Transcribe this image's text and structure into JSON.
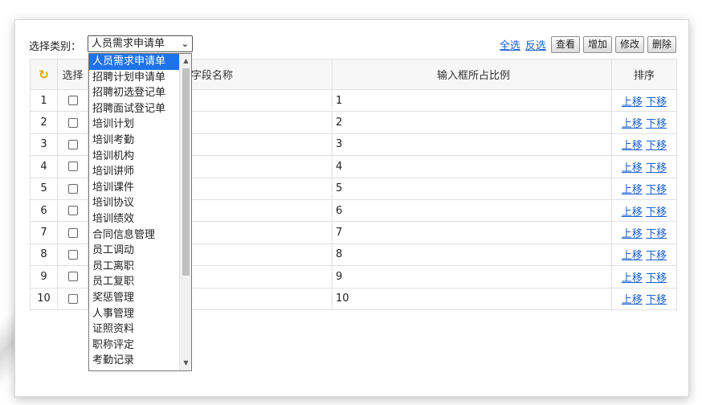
{
  "toolbar": {
    "category_label": "选择类别：",
    "category_value": "人员需求申请单",
    "select_all": "全选",
    "invert": "反选",
    "buttons": [
      "查看",
      "增加",
      "修改",
      "删除"
    ]
  },
  "table": {
    "headers": {
      "select": "选择",
      "field_name": "字段名称",
      "ratio": "输入框所占比例",
      "sort": "排序"
    },
    "rows": [
      {
        "idx": "1",
        "ratio": "1"
      },
      {
        "idx": "2",
        "ratio": "2"
      },
      {
        "idx": "3",
        "ratio": "3"
      },
      {
        "idx": "4",
        "ratio": "4"
      },
      {
        "idx": "5",
        "ratio": "5"
      },
      {
        "idx": "6",
        "ratio": "6"
      },
      {
        "idx": "7",
        "ratio": "7"
      },
      {
        "idx": "8",
        "ratio": "8"
      },
      {
        "idx": "9",
        "ratio": "9"
      },
      {
        "idx": "10",
        "ratio": "10"
      }
    ],
    "move_up": "上移",
    "move_down": "下移"
  },
  "dropdown": {
    "options": [
      "人员需求申请单",
      "招聘计划申请单",
      "招聘初选登记单",
      "招聘面试登记单",
      "培训计划",
      "培训考勤",
      "培训机构",
      "培训讲师",
      "培训课件",
      "培训协议",
      "培训绩效",
      "合同信息管理",
      "员工调动",
      "员工离职",
      "员工复职",
      "奖惩管理",
      "人事管理",
      "证照资料",
      "职称评定",
      "考勤记录"
    ],
    "selected_index": 0
  },
  "colors": {
    "accent": "#1e73e8",
    "link": "#1a5fd0",
    "icon": "#e7a400"
  }
}
